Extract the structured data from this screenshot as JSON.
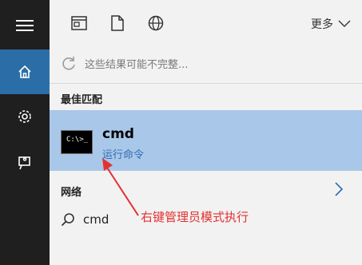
{
  "sidebar": {
    "items": [
      {
        "name": "menu"
      },
      {
        "name": "home"
      },
      {
        "name": "settings"
      },
      {
        "name": "feedback"
      }
    ]
  },
  "toolbar": {
    "more_label": "更多"
  },
  "notice": {
    "text": "这些结果可能不完整..."
  },
  "sections": {
    "best_match": "最佳匹配",
    "network": "网络"
  },
  "result": {
    "title": "cmd",
    "subtitle": "运行命令",
    "icon_glyph": "C:\\>_"
  },
  "search": {
    "query": "cmd"
  },
  "annotation": {
    "text": "右键管理员模式执行",
    "color": "#e23131"
  },
  "colors": {
    "sidebar_bg": "#1f1f1f",
    "active_bg": "#2b6ea7",
    "selected_result_bg": "#a9c7e8",
    "link_blue": "#2f6db4"
  }
}
